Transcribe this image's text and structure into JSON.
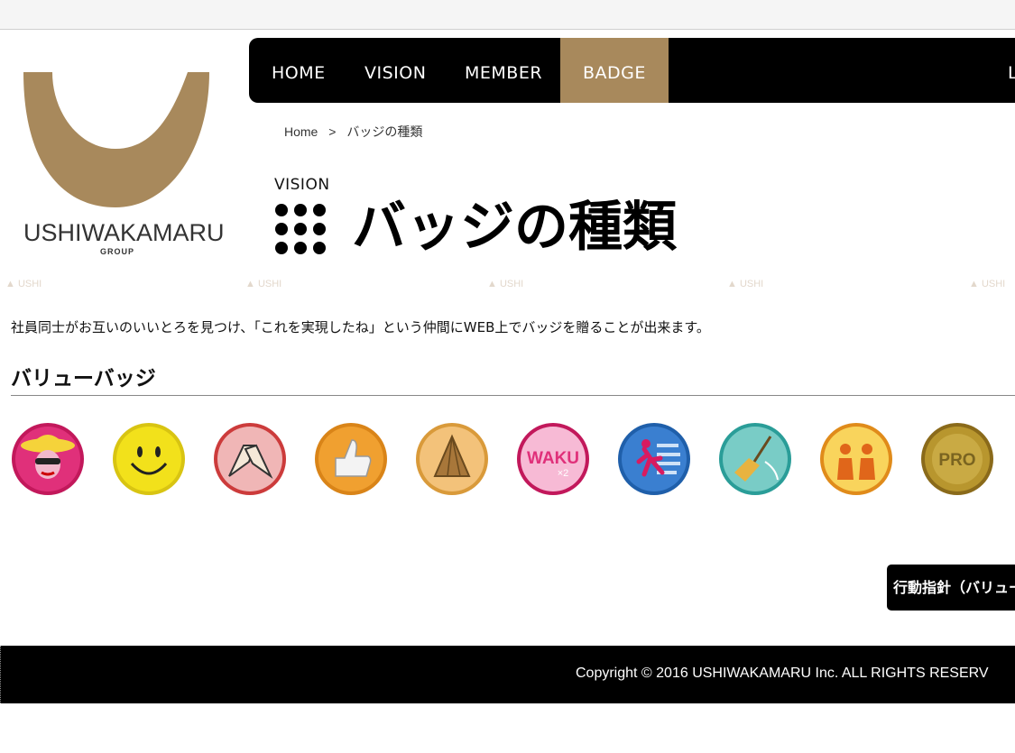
{
  "logo": {
    "text": "USHIWAKAMARU",
    "sub": "GROUP",
    "color": "#a8895c"
  },
  "nav": {
    "items": [
      {
        "label": "HOME"
      },
      {
        "label": "VISION"
      },
      {
        "label": "MEMBER"
      },
      {
        "label": "BADGE",
        "active": true
      },
      {
        "label": "L"
      }
    ],
    "active_color": "#a8895c"
  },
  "breadcrumb": {
    "home": "Home",
    "separator": ">",
    "current": "バッジの種類"
  },
  "header": {
    "label": "VISION",
    "title": "バッジの種類"
  },
  "intro": "社員同士がお互いのいいとろを見つけ、「これを実現したね」という仲間にWEB上でバッジを贈ることが出来ます。",
  "section": {
    "title": "バリューバッジ"
  },
  "badges": [
    {
      "icon": "hat-lady-icon",
      "color": "#e0307a"
    },
    {
      "icon": "smiley-icon",
      "color": "#f2e11b"
    },
    {
      "icon": "handshake-icon",
      "color": "#e5a3a3"
    },
    {
      "icon": "thumbs-up-icon",
      "color": "#f0a030"
    },
    {
      "icon": "bamboo-shoot-icon",
      "color": "#f3c27a"
    },
    {
      "icon": "waku-icon",
      "text": "WAKU",
      "sub": "×2",
      "color": "#f283b5"
    },
    {
      "icon": "running-icon",
      "color": "#3a7fd0"
    },
    {
      "icon": "broom-icon",
      "color": "#47b5b0"
    },
    {
      "icon": "people-icon",
      "color": "#f5a63a"
    },
    {
      "icon": "pro-icon",
      "text": "PRO",
      "color": "#b8962e"
    }
  ],
  "cta": {
    "label": "行動指針（バリュー"
  },
  "footer": {
    "copyright": "Copyright © 2016 USHIWAKAMARU Inc. ALL RIGHTS RESERV"
  }
}
